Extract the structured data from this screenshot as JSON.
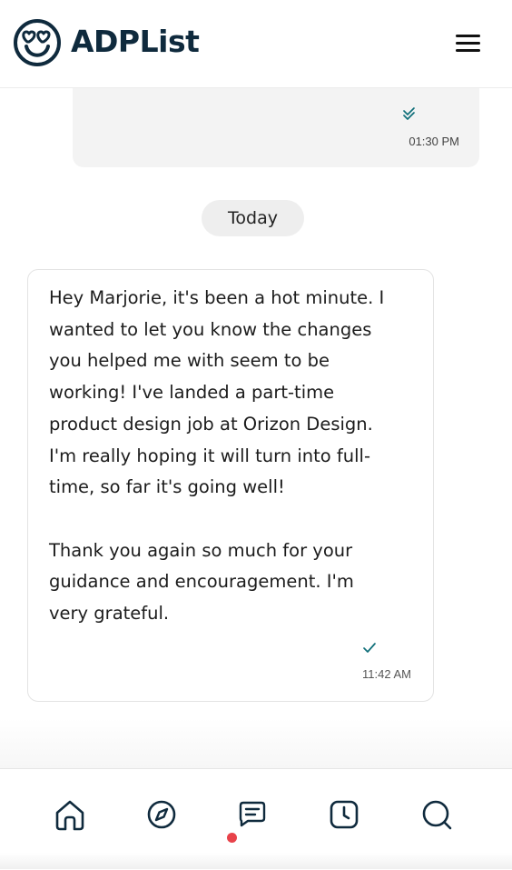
{
  "app": {
    "name": "ADPList",
    "brand_color": "#0f2a3d",
    "accent_color": "#0e6e79",
    "notification_color": "#e8424a"
  },
  "header": {
    "logo_icon": "heart-eyes-smiley-icon",
    "menu_icon": "hamburger-menu-icon"
  },
  "chat": {
    "previous_message": {
      "status_icon": "double-check-icon",
      "time": "01:30 PM"
    },
    "date_divider": "Today",
    "message": {
      "text": "Hey Marjorie, it's been a hot minute. I\nwanted to let you know the changes\nyou helped me with seem to be\nworking! I've landed a part-time\nproduct design job at Orizon Design.\nI'm really hoping it will turn into full-\ntime, so far it's going well!\n\nThank you again so much for your\nguidance and encouragement. I'm\nvery grateful.",
      "status_icon": "check-icon",
      "time": "11:42 AM"
    }
  },
  "bottom_nav": {
    "items": [
      {
        "icon": "home-icon"
      },
      {
        "icon": "compass-icon"
      },
      {
        "icon": "chat-bubble-icon",
        "active": true,
        "has_notification": true
      },
      {
        "icon": "clock-icon"
      },
      {
        "icon": "search-icon"
      }
    ]
  }
}
